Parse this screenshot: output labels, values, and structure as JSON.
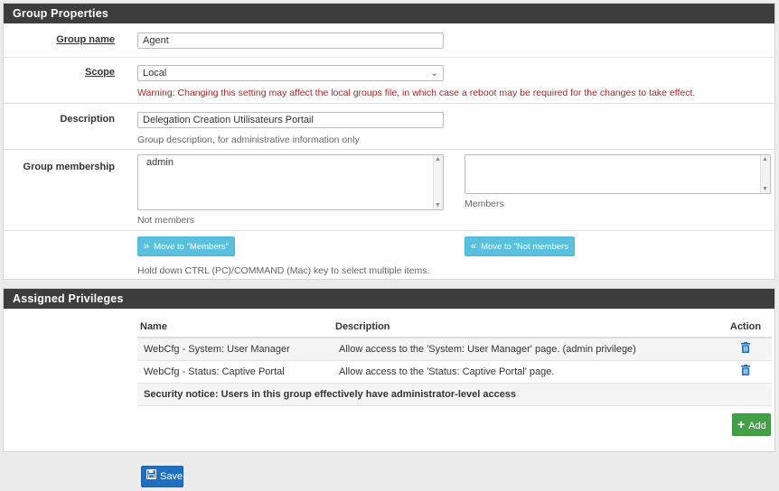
{
  "group_properties": {
    "title": "Group Properties",
    "group_name": {
      "label": "Group name",
      "value": "Agent"
    },
    "scope": {
      "label": "Scope",
      "value": "Local",
      "warning": "Warning: Changing this setting may affect the local groups file, in which case a reboot may be required for the changes to take effect."
    },
    "description": {
      "label": "Description",
      "value": "Delegation Creation Utilisateurs Portail",
      "help": "Group description, for administrative information only"
    },
    "membership": {
      "label": "Group membership",
      "not_members": [
        "admin"
      ],
      "not_members_caption": "Not members",
      "members": [],
      "members_caption": "Members",
      "move_to_members": "Move to \"Members\"",
      "move_to_not_members": "Move to \"Not members",
      "help": "Hold down CTRL (PC)/COMMAND (Mac) key to select multiple items."
    }
  },
  "privileges": {
    "title": "Assigned Privileges",
    "columns": [
      "Name",
      "Description",
      "Action"
    ],
    "rows": [
      {
        "name": "WebCfg - System: User Manager",
        "description": "Allow access to the 'System: User Manager' page. (admin privilege)"
      },
      {
        "name": "WebCfg - Status: Captive Portal",
        "description": "Allow access to the 'Status: Captive Portal' page."
      }
    ],
    "notice": "Security notice: Users in this group effectively have administrator-level access",
    "add_label": "Add"
  },
  "save_label": "Save",
  "colors": {
    "header": "#3d3d3d",
    "info": "#5bc0de",
    "success": "#43a047",
    "primary": "#1e6fc2",
    "warning_text": "#b22222",
    "trash": "#1e6fc2"
  }
}
